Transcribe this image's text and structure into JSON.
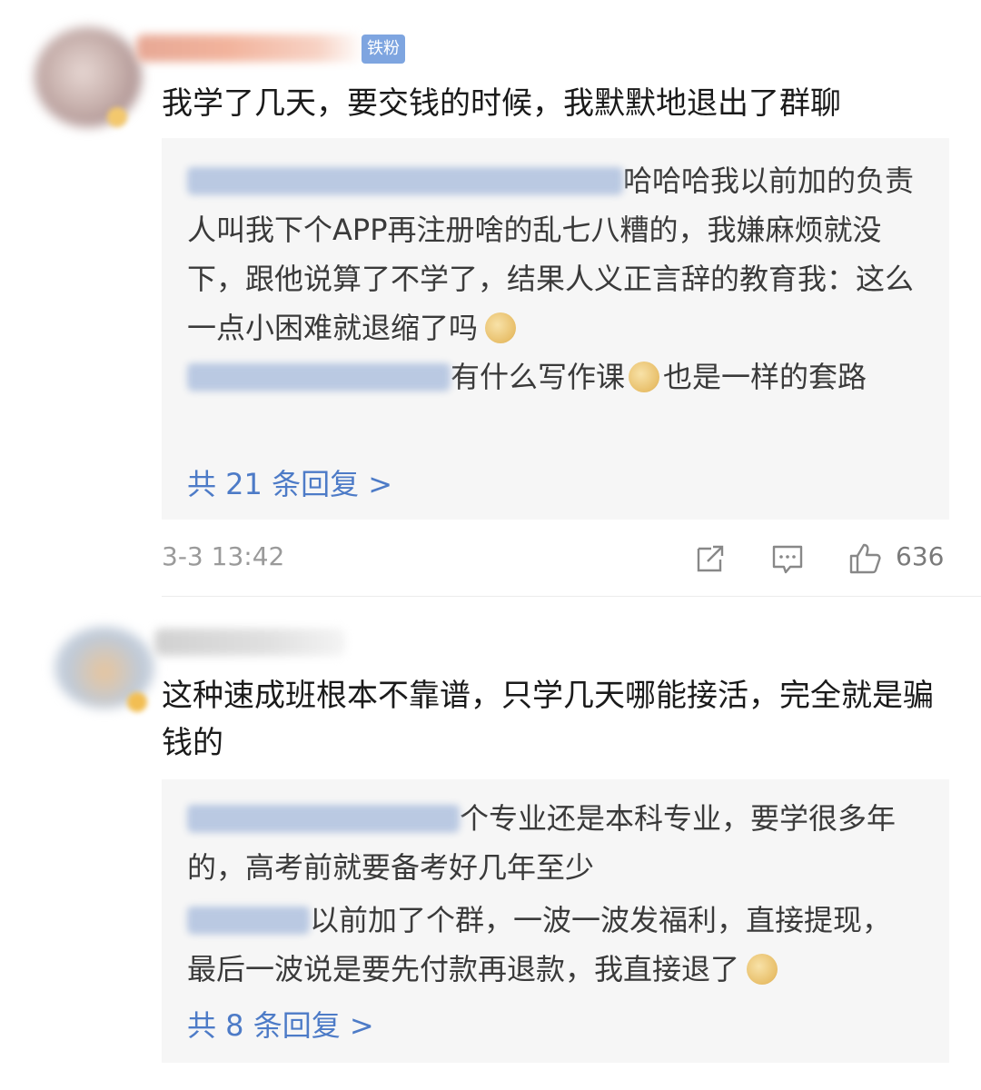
{
  "comments": [
    {
      "badge": "铁粉",
      "text": "我学了几天，要交钱的时候，我默默地退出了群聊",
      "replies": [
        {
          "text": "哈哈哈我以前加的负责人叫我下个APP再注册啥的乱七八糟的，我嫌麻烦就没下，跟他说算了不学了，结果人义正言辞的教育我：这么一点小困难就退缩了吗"
        },
        {
          "text": "有什么写作课",
          "tail": "也是一样的套路"
        }
      ],
      "more": "共 21 条回复 >",
      "timestamp": "3-3 13:42",
      "likes": "636"
    },
    {
      "text": "这种速成班根本不靠谱，只学几天哪能接活，完全就是骗钱的",
      "replies": [
        {
          "text": "个专业还是本科专业，要学很多年的，高考前就要备考好几年至少"
        },
        {
          "text": "以前加了个群，一波一波发福利，直接提现，最后一波说是要先付款再退款，我直接退了"
        }
      ],
      "more": "共 8 条回复 >"
    }
  ],
  "icons": {
    "share": "share-icon",
    "comment": "comment-icon",
    "like": "like-icon",
    "emoji_doge": "doge-emoji",
    "emoji_laugh": "laugh-cry-emoji"
  },
  "colors": {
    "link": "#4d7bc7",
    "badge": "#7ea5e0",
    "reply_bg": "#f6f6f6"
  }
}
